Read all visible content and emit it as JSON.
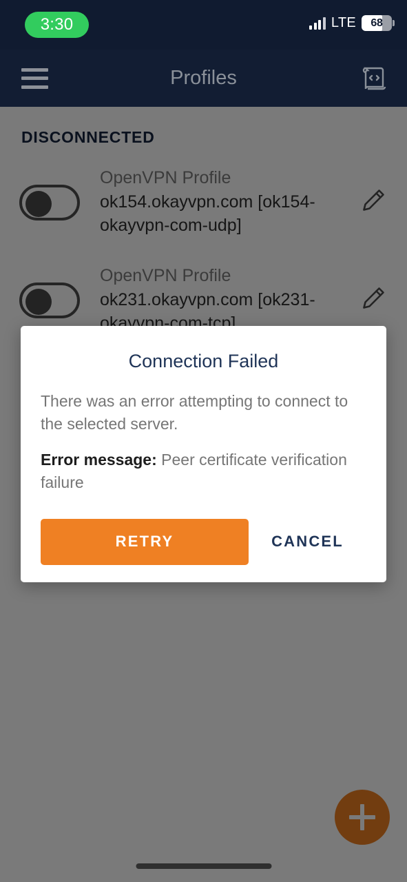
{
  "status_bar": {
    "time": "3:30",
    "time_pill_color": "#32cc5e",
    "network_label": "LTE",
    "battery_level": "68",
    "signal_bars": 3,
    "signal_bars_total": 4
  },
  "app_bar": {
    "title": "Profiles",
    "background_color": "#121d33",
    "menu_icon": "hamburger-menu-icon",
    "import_icon": "scroll-code-icon"
  },
  "profiles_screen": {
    "section_header": "DISCONNECTED",
    "rows": [
      {
        "kind": "OpenVPN Profile",
        "name": "ok154.okayvpn.com [ok154-okayvpn-com-udp]",
        "toggle_state": "off",
        "edit_icon": "pencil-icon"
      },
      {
        "kind": "OpenVPN Profile",
        "name": "ok231.okayvpn.com [ok231-okayvpn-com-tcp]",
        "toggle_state": "off",
        "edit_icon": "pencil-icon"
      }
    ],
    "fab": {
      "icon": "plus-icon",
      "color": "#ef8023"
    }
  },
  "dialog": {
    "title": "Connection Failed",
    "body_line1": "There was an error attempting to connect to the selected server.",
    "error_label": "Error message:",
    "error_text": " Peer certificate verification failure",
    "primary_button": "RETRY",
    "secondary_button": "CANCEL",
    "primary_color": "#ef8023",
    "title_color": "#1f3457"
  }
}
